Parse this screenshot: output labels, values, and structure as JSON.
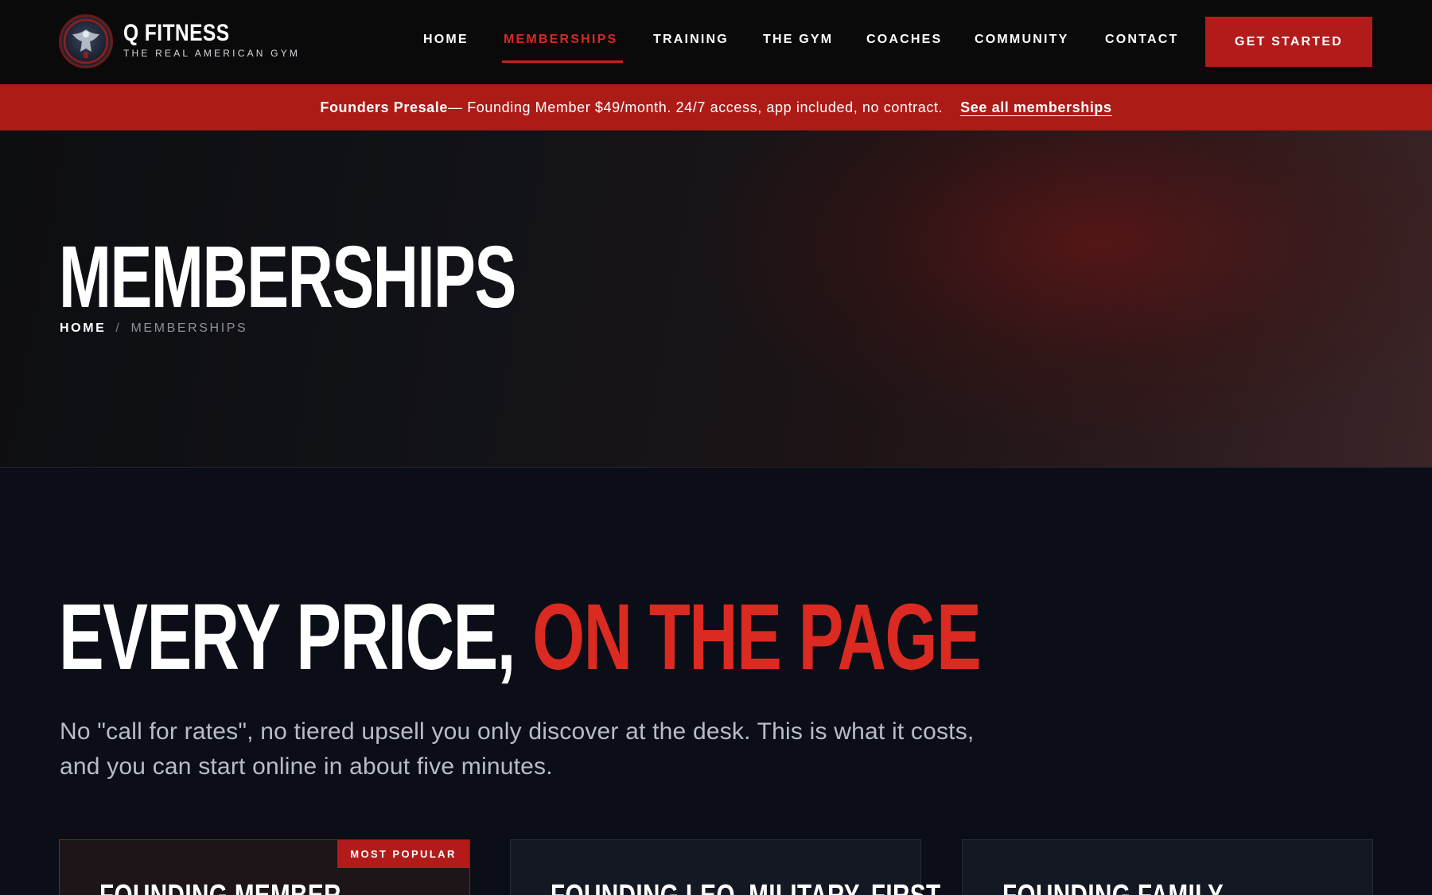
{
  "header": {
    "brand_name": "Q FITNESS",
    "brand_tagline": "THE REAL AMERICAN GYM",
    "logo_icon": "eagle-emblem-icon",
    "nav": [
      {
        "label": "HOME",
        "active": false
      },
      {
        "label": "MEMBERSHIPS",
        "active": true
      },
      {
        "label": "TRAINING",
        "active": false
      },
      {
        "label": "THE GYM",
        "active": false
      },
      {
        "label": "COACHES",
        "active": false
      },
      {
        "label": "COMMUNITY",
        "active": false
      },
      {
        "label": "CONTACT",
        "active": false
      }
    ],
    "cta_label": "GET STARTED"
  },
  "promo": {
    "bold": "Founders Presale",
    "text": " — Founding Member $49/month. 24/7 access, app included, no contract.",
    "link": "See all memberships"
  },
  "hero": {
    "title": "MEMBERSHIPS",
    "breadcrumb": {
      "home": "HOME",
      "separator": "/",
      "current": "MEMBERSHIPS"
    }
  },
  "pricing": {
    "heading_main": "EVERY PRICE, ",
    "heading_accent": "ON THE PAGE",
    "intro": "No \"call for rates\", no tiered upsell you only discover at the desk. This is what it costs, and you can start online in about five minutes.",
    "cards": [
      {
        "title": "FOUNDING MEMBER",
        "badge": "MOST POPULAR",
        "featured": true
      },
      {
        "title": "FOUNDING LEO, MILITARY, FIRST",
        "badge": "",
        "featured": false
      },
      {
        "title": "FOUNDING FAMILY",
        "badge": "",
        "featured": false
      }
    ]
  },
  "colors": {
    "accent": "#d9291f",
    "promo_bg": "#ad1b17",
    "page_bg": "#0b0e17",
    "header_bg": "#0a0a0b"
  }
}
